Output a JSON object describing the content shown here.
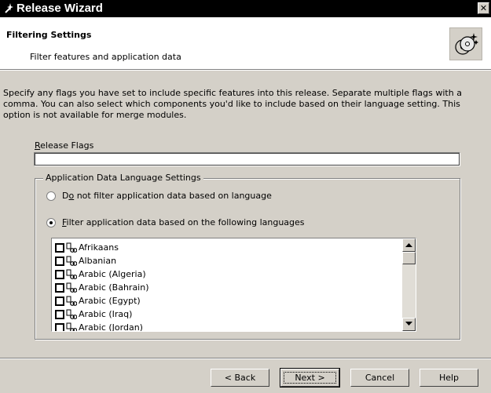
{
  "window": {
    "title": "Release Wizard",
    "close_glyph": "✕"
  },
  "header": {
    "title": "Filtering Settings",
    "subtitle": "Filter features and application data",
    "icon": "cd-wizard-icon"
  },
  "description": "Specify any flags you have set to include specific features into this release. Separate multiple flags with a comma. You can also select which components you'd like to include based on their language setting. This option is not available for merge modules.",
  "release_flags": {
    "label_key": "R",
    "label_rest": "elease Flags",
    "value": ""
  },
  "language_group": {
    "title": "Application Data Language Settings",
    "option_no_filter": {
      "pre": "D",
      "key": "o",
      "post": " not filter application data based on language",
      "selected": false
    },
    "option_filter": {
      "pre": "",
      "key": "F",
      "post": "ilter application data based on the following languages",
      "selected": true
    },
    "languages": [
      {
        "name": "Afrikaans",
        "checked": false
      },
      {
        "name": "Albanian",
        "checked": false
      },
      {
        "name": "Arabic (Algeria)",
        "checked": false
      },
      {
        "name": "Arabic (Bahrain)",
        "checked": false
      },
      {
        "name": "Arabic (Egypt)",
        "checked": false
      },
      {
        "name": "Arabic (Iraq)",
        "checked": false
      },
      {
        "name": "Arabic (Jordan)",
        "checked": false
      }
    ]
  },
  "buttons": {
    "back": "< Back",
    "next": "Next >",
    "cancel": "Cancel",
    "help": "Help"
  }
}
